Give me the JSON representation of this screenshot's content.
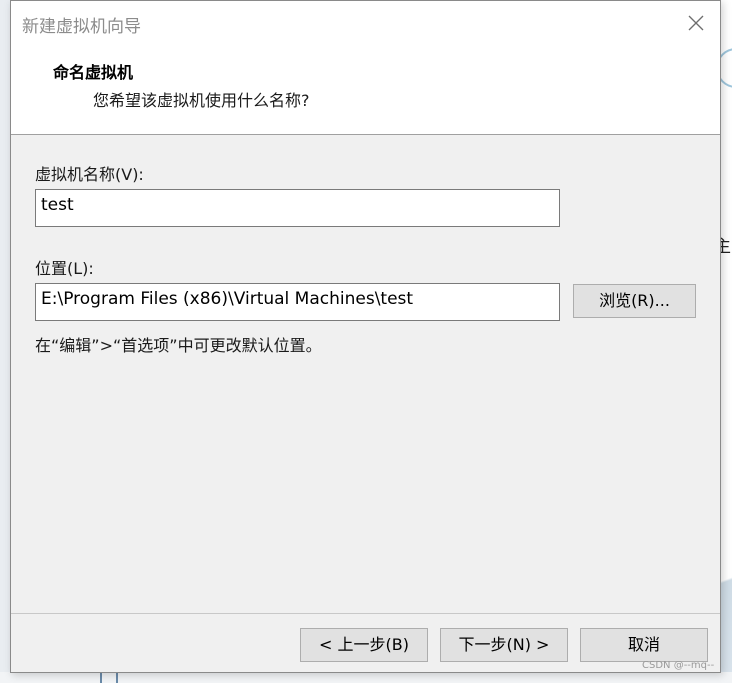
{
  "dialog": {
    "title": "新建虚拟机向导",
    "header": {
      "title": "命名虚拟机",
      "subtitle": "您希望该虚拟机使用什么名称?"
    },
    "name_field": {
      "label": "虚拟机名称(V):",
      "value": "test"
    },
    "location_field": {
      "label": "位置(L):",
      "value": "E:\\Program Files (x86)\\Virtual Machines\\test",
      "browse_label": "浏览(R)..."
    },
    "hint": "在“编辑”>“首选项”中可更改默认位置。",
    "buttons": {
      "back": "< 上一步(B)",
      "next": "下一步(N) >",
      "cancel": "取消"
    }
  },
  "background": {
    "partial_text": "主扌"
  },
  "watermark": "CSDN @--mq--"
}
